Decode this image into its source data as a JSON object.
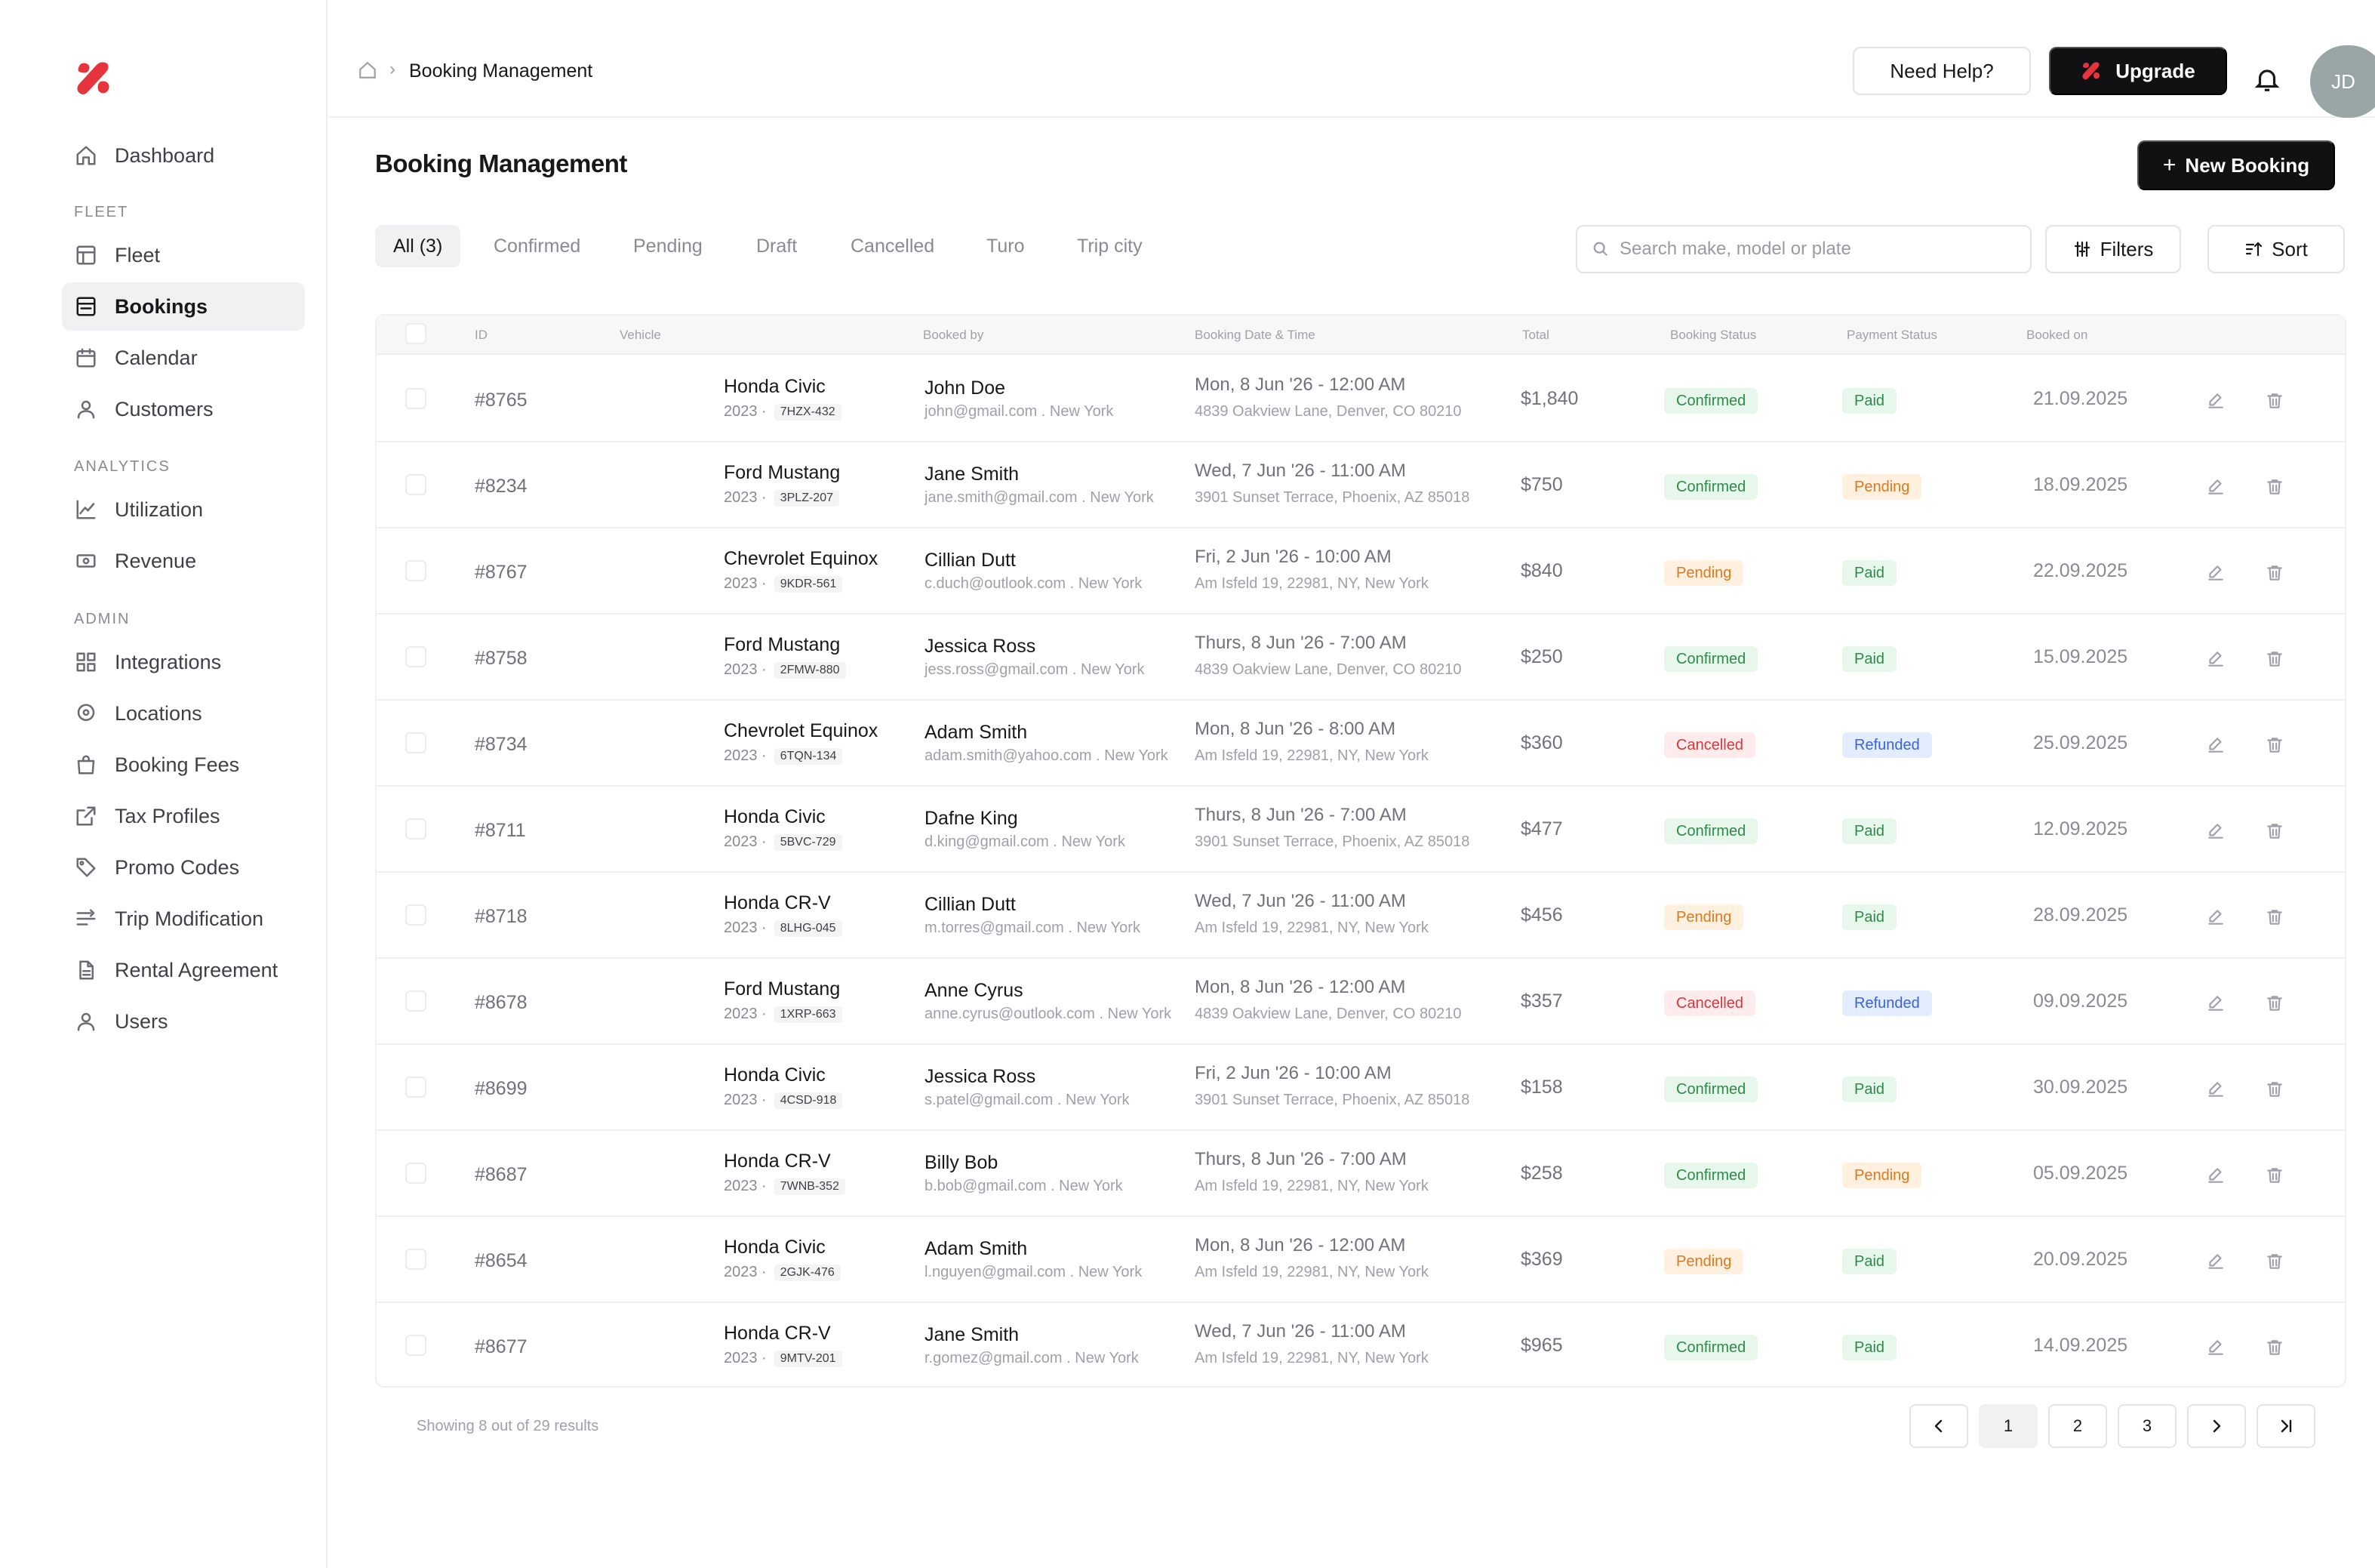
{
  "colors": {
    "accent": "#e5343c",
    "primary_button": "#111113",
    "confirmed": "#2f8a4a",
    "pending": "#d97a20",
    "cancelled": "#d9363e",
    "refunded": "#3a64d8"
  },
  "sidebar": {
    "logo_icon": "brand-logo-icon",
    "dashboard": "Dashboard",
    "fleet_section": "FLEET",
    "fleet_items": [
      {
        "label": "Fleet",
        "icon": "table-icon"
      },
      {
        "label": "Bookings",
        "icon": "bookings-icon",
        "active": true
      },
      {
        "label": "Calendar",
        "icon": "calendar-icon"
      },
      {
        "label": "Customers",
        "icon": "user-icon"
      }
    ],
    "analytics_section": "ANALYTICS",
    "analytics_items": [
      {
        "label": "Utilization",
        "icon": "line-chart-icon"
      },
      {
        "label": "Revenue",
        "icon": "money-icon"
      }
    ],
    "admin_section": "ADMIN",
    "admin_items": [
      {
        "label": "Integrations",
        "icon": "grid-icon"
      },
      {
        "label": "Locations",
        "icon": "location-pin-icon"
      },
      {
        "label": "Booking Fees",
        "icon": "bag-icon"
      },
      {
        "label": "Tax Profiles",
        "icon": "external-link-icon"
      },
      {
        "label": "Promo Codes",
        "icon": "tag-icon"
      },
      {
        "label": "Trip Modification",
        "icon": "sliders-icon"
      },
      {
        "label": "Rental Agreement",
        "icon": "document-icon"
      },
      {
        "label": "Users",
        "icon": "user-icon"
      }
    ]
  },
  "header": {
    "breadcrumb_current": "Booking Management",
    "help_label": "Need Help?",
    "upgrade_label": "Upgrade",
    "avatar_initials": "JD"
  },
  "page": {
    "title": "Booking Management",
    "new_booking_label": "New Booking"
  },
  "tabs": [
    "All (3)",
    "Confirmed",
    "Pending",
    "Draft",
    "Cancelled",
    "Turo",
    "Trip city"
  ],
  "search": {
    "placeholder": "Search make, model or plate",
    "value": ""
  },
  "filters_label": "Filters",
  "sort_label": "Sort",
  "table": {
    "columns": [
      "ID",
      "Vehicle",
      "Booked by",
      "Booking Date & Time",
      "Total",
      "Booking Status",
      "Payment Status",
      "Booked on"
    ],
    "rows": [
      {
        "id": "#8765",
        "vehicle": "Honda Civic",
        "year": "2023 ·",
        "plate": "7HZX-432",
        "name": "John Doe",
        "email": "john@gmail.com . New York",
        "date": "Mon, 8 Jun '26 - 12:00 AM",
        "address": "4839 Oakview Lane, Denver, CO 80210",
        "total": "$1,840",
        "booking_status": "Confirmed",
        "payment_status": "Paid",
        "booked_on": "21.09.2025"
      },
      {
        "id": "#8234",
        "vehicle": "Ford Mustang",
        "year": "2023 ·",
        "plate": "3PLZ-207",
        "name": "Jane Smith",
        "email": "jane.smith@gmail.com . New York",
        "date": "Wed, 7 Jun '26 - 11:00 AM",
        "address": "3901 Sunset Terrace, Phoenix, AZ 85018",
        "total": "$750",
        "booking_status": "Confirmed",
        "payment_status": "Pending",
        "booked_on": "18.09.2025"
      },
      {
        "id": "#8767",
        "vehicle": "Chevrolet Equinox",
        "year": "2023 ·",
        "plate": "9KDR-561",
        "name": "Cillian Dutt",
        "email": "c.duch@outlook.com . New York",
        "date": "Fri, 2 Jun '26 - 10:00 AM",
        "address": "Am Isfeld 19, 22981, NY, New York",
        "total": "$840",
        "booking_status": "Pending",
        "payment_status": "Paid",
        "booked_on": "22.09.2025"
      },
      {
        "id": "#8758",
        "vehicle": "Ford Mustang",
        "year": "2023 ·",
        "plate": "2FMW-880",
        "name": "Jessica Ross",
        "email": "jess.ross@gmail.com . New York",
        "date": "Thurs, 8 Jun '26 - 7:00 AM",
        "address": "4839 Oakview Lane, Denver, CO 80210",
        "total": "$250",
        "booking_status": "Confirmed",
        "payment_status": "Paid",
        "booked_on": "15.09.2025"
      },
      {
        "id": "#8734",
        "vehicle": "Chevrolet Equinox",
        "year": "2023 ·",
        "plate": "6TQN-134",
        "name": "Adam Smith",
        "email": "adam.smith@yahoo.com . New York",
        "date": "Mon, 8 Jun '26 - 8:00 AM",
        "address": "Am Isfeld 19, 22981, NY, New York",
        "total": "$360",
        "booking_status": "Cancelled",
        "payment_status": "Refunded",
        "booked_on": "25.09.2025"
      },
      {
        "id": "#8711",
        "vehicle": "Honda Civic",
        "year": "2023 ·",
        "plate": "5BVC-729",
        "name": "Dafne King",
        "email": "d.king@gmail.com . New York",
        "date": "Thurs, 8 Jun '26 - 7:00 AM",
        "address": "3901 Sunset Terrace, Phoenix, AZ 85018",
        "total": "$477",
        "booking_status": "Confirmed",
        "payment_status": "Paid",
        "booked_on": "12.09.2025"
      },
      {
        "id": "#8718",
        "vehicle": "Honda CR-V",
        "year": "2023 ·",
        "plate": "8LHG-045",
        "name": "Cillian Dutt",
        "email": "m.torres@gmail.com . New York",
        "date": "Wed, 7 Jun '26 - 11:00 AM",
        "address": "Am Isfeld 19, 22981, NY, New York",
        "total": "$456",
        "booking_status": "Pending",
        "payment_status": "Paid",
        "booked_on": "28.09.2025"
      },
      {
        "id": "#8678",
        "vehicle": "Ford Mustang",
        "year": "2023 ·",
        "plate": "1XRP-663",
        "name": "Anne Cyrus",
        "email": "anne.cyrus@outlook.com . New York",
        "date": "Mon, 8 Jun '26 - 12:00 AM",
        "address": "4839 Oakview Lane, Denver, CO 80210",
        "total": "$357",
        "booking_status": "Cancelled",
        "payment_status": "Refunded",
        "booked_on": "09.09.2025"
      },
      {
        "id": "#8699",
        "vehicle": "Honda Civic",
        "year": "2023 ·",
        "plate": "4CSD-918",
        "name": "Jessica Ross",
        "email": "s.patel@gmail.com . New York",
        "date": "Fri, 2 Jun '26 - 10:00 AM",
        "address": "3901 Sunset Terrace, Phoenix, AZ 85018",
        "total": "$158",
        "booking_status": "Confirmed",
        "payment_status": "Paid",
        "booked_on": "30.09.2025"
      },
      {
        "id": "#8687",
        "vehicle": "Honda CR-V",
        "year": "2023 ·",
        "plate": "7WNB-352",
        "name": "Billy Bob",
        "email": "b.bob@gmail.com . New York",
        "date": "Thurs, 8 Jun '26 - 7:00 AM",
        "address": "Am Isfeld 19, 22981, NY, New York",
        "total": "$258",
        "booking_status": "Confirmed",
        "payment_status": "Pending",
        "booked_on": "05.09.2025"
      },
      {
        "id": "#8654",
        "vehicle": "Honda Civic",
        "year": "2023 ·",
        "plate": "2GJK-476",
        "name": "Adam Smith",
        "email": "l.nguyen@gmail.com . New York",
        "date": "Mon, 8 Jun '26 - 12:00 AM",
        "address": "Am Isfeld 19, 22981, NY, New York",
        "total": "$369",
        "booking_status": "Pending",
        "payment_status": "Paid",
        "booked_on": "20.09.2025"
      },
      {
        "id": "#8677",
        "vehicle": "Honda CR-V",
        "year": "2023 ·",
        "plate": "9MTV-201",
        "name": "Jane Smith",
        "email": "r.gomez@gmail.com . New York",
        "date": "Wed, 7 Jun '26 - 11:00 AM",
        "address": "Am Isfeld 19, 22981, NY, New York",
        "total": "$965",
        "booking_status": "Confirmed",
        "payment_status": "Paid",
        "booked_on": "14.09.2025"
      }
    ]
  },
  "pagination": {
    "summary": "Showing 8 out of 29 results",
    "pages": [
      "1",
      "2",
      "3"
    ],
    "current_page": "1"
  }
}
